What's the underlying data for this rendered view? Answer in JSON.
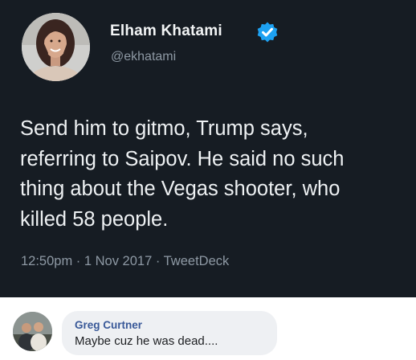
{
  "tweet": {
    "author_name": "Elham Khatami",
    "handle": "@ekhatami",
    "verified_icon": "verified-badge-icon",
    "text": "Send him to gitmo, Trump says,\nreferring to Saipov. He said no such\nthing about the Vegas shooter, who\nkilled 58 people.",
    "meta": "12:50pm · 1 Nov 2017 · TweetDeck",
    "colors": {
      "card_background": "#161c23",
      "text": "#eef1f3",
      "secondary_text": "#8e99a4",
      "verified_blue": "#1da1f2"
    }
  },
  "comment": {
    "author": "Greg Curtner",
    "text": "Maybe cuz he was dead....",
    "colors": {
      "bubble": "#eef0f3",
      "author": "#385898",
      "text": "#1c1e21"
    }
  }
}
